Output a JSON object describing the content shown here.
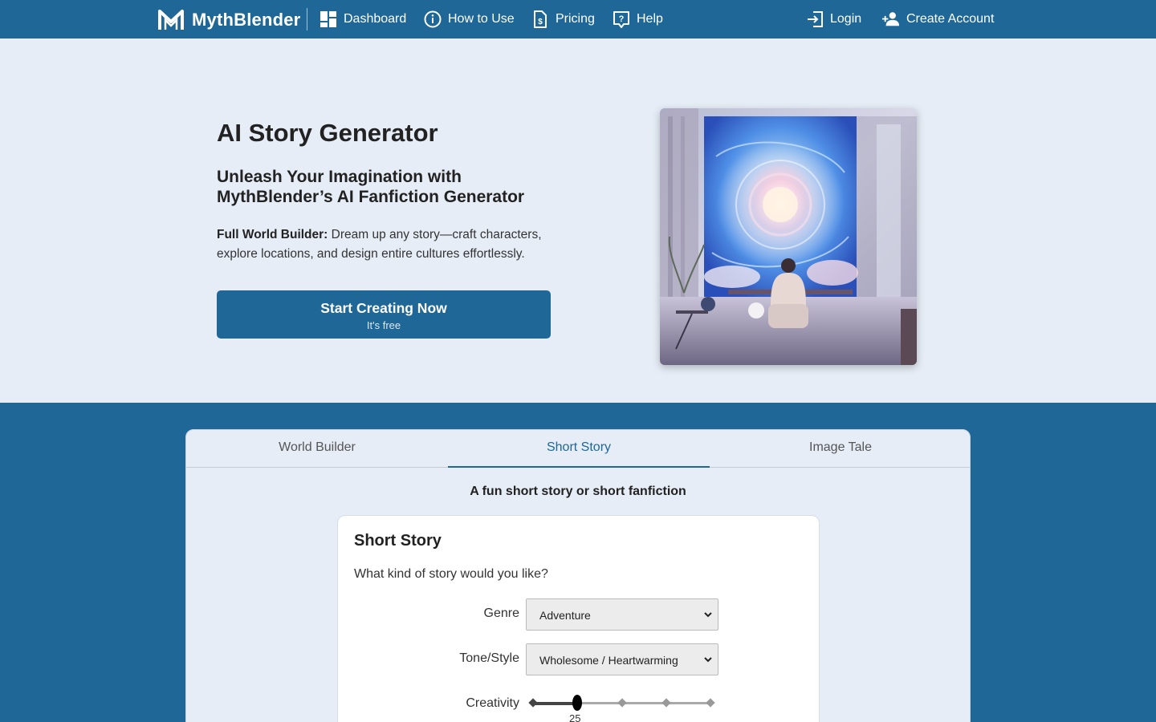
{
  "nav": {
    "brand": "MythBlender",
    "items": [
      {
        "label": "Dashboard",
        "icon": "dashboard-icon"
      },
      {
        "label": "How to Use",
        "icon": "info-icon"
      },
      {
        "label": "Pricing",
        "icon": "pricing-icon"
      },
      {
        "label": "Help",
        "icon": "help-icon"
      }
    ],
    "login": "Login",
    "create_account": "Create Account"
  },
  "hero": {
    "title": "AI Story Generator",
    "subtitle": "Unleash Your Imagination with MythBlender’s AI Fanfiction Generator",
    "desc_bold": "Full World Builder:",
    "desc_rest": " Dream up any story—craft characters, explore locations, and design entire cultures effortlessly.",
    "cta_main": "Start Creating Now",
    "cta_sub": "It's free"
  },
  "tabs": [
    {
      "label": "World Builder",
      "active": false
    },
    {
      "label": "Short Story",
      "active": true
    },
    {
      "label": "Image Tale",
      "active": false
    }
  ],
  "panel": {
    "caption": "A fun short story or short fanfiction",
    "card_title": "Short Story",
    "question": "What kind of story would you like?",
    "genre_label": "Genre",
    "genre_value": "Adventure",
    "tone_label": "Tone/Style",
    "tone_value": "Wholesome / Heartwarming",
    "creativity_label": "Creativity",
    "creativity_value": "25"
  },
  "colors": {
    "primary": "#1e6796",
    "background": "#e6edf6"
  }
}
